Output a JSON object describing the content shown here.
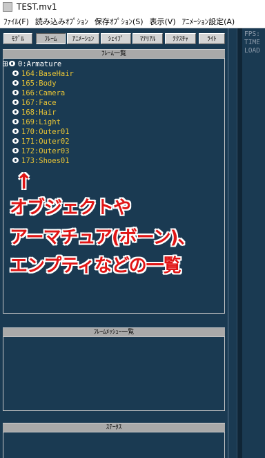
{
  "window": {
    "title": "TEST.mv1"
  },
  "menu": [
    {
      "label": "ﾌｧｲﾙ(F)"
    },
    {
      "label": "読み込みｵﾌﾟｼｮﾝ"
    },
    {
      "label": "保存ｵﾌﾟｼｮﾝ(S)"
    },
    {
      "label": "表示(V)"
    },
    {
      "label": "ｱﾆﾒｰｼｮﾝ設定(A)"
    }
  ],
  "tabs": [
    {
      "label": "ﾓﾃﾞﾙ",
      "active": false
    },
    {
      "label": "ﾌﾚｰﾑ",
      "active": true
    },
    {
      "label": "ｱﾆﾒｰｼｮﾝ",
      "active": false
    },
    {
      "label": "ｼｪｲﾌﾟ",
      "active": false
    },
    {
      "label": "ﾏﾃﾘｱﾙ",
      "active": false
    },
    {
      "label": "ﾃｸｽﾁｬ",
      "active": false
    },
    {
      "label": "ﾗｲﾄ",
      "active": false
    }
  ],
  "frame_list": {
    "header": "ﾌﾚｰﾑ一覧",
    "items": [
      {
        "label": "0:Armature",
        "expandable": true
      },
      {
        "label": "164:BaseHair"
      },
      {
        "label": "165:Body"
      },
      {
        "label": "166:Camera"
      },
      {
        "label": "167:Face"
      },
      {
        "label": "168:Hair"
      },
      {
        "label": "169:Light"
      },
      {
        "label": "170:Outer01"
      },
      {
        "label": "171:Outer02"
      },
      {
        "label": "172:Outer03"
      },
      {
        "label": "173:Shoes01"
      }
    ]
  },
  "annotation": {
    "arrow": "↑",
    "lines": [
      "オブジェクトや",
      "アーマチュア(ボーン)、",
      "エンプティなどの一覧"
    ],
    "color": "#e01515"
  },
  "frame_mesh_list": {
    "header": "ﾌﾚｰﾑﾒｯｼｭｰ一覧"
  },
  "status": {
    "header": "ｽﾃｰﾀｽ"
  },
  "info": [
    "FPS:",
    "TIME",
    "LOAD"
  ],
  "colors": {
    "background": "#1a3a52",
    "item_text": "#e8c436"
  }
}
